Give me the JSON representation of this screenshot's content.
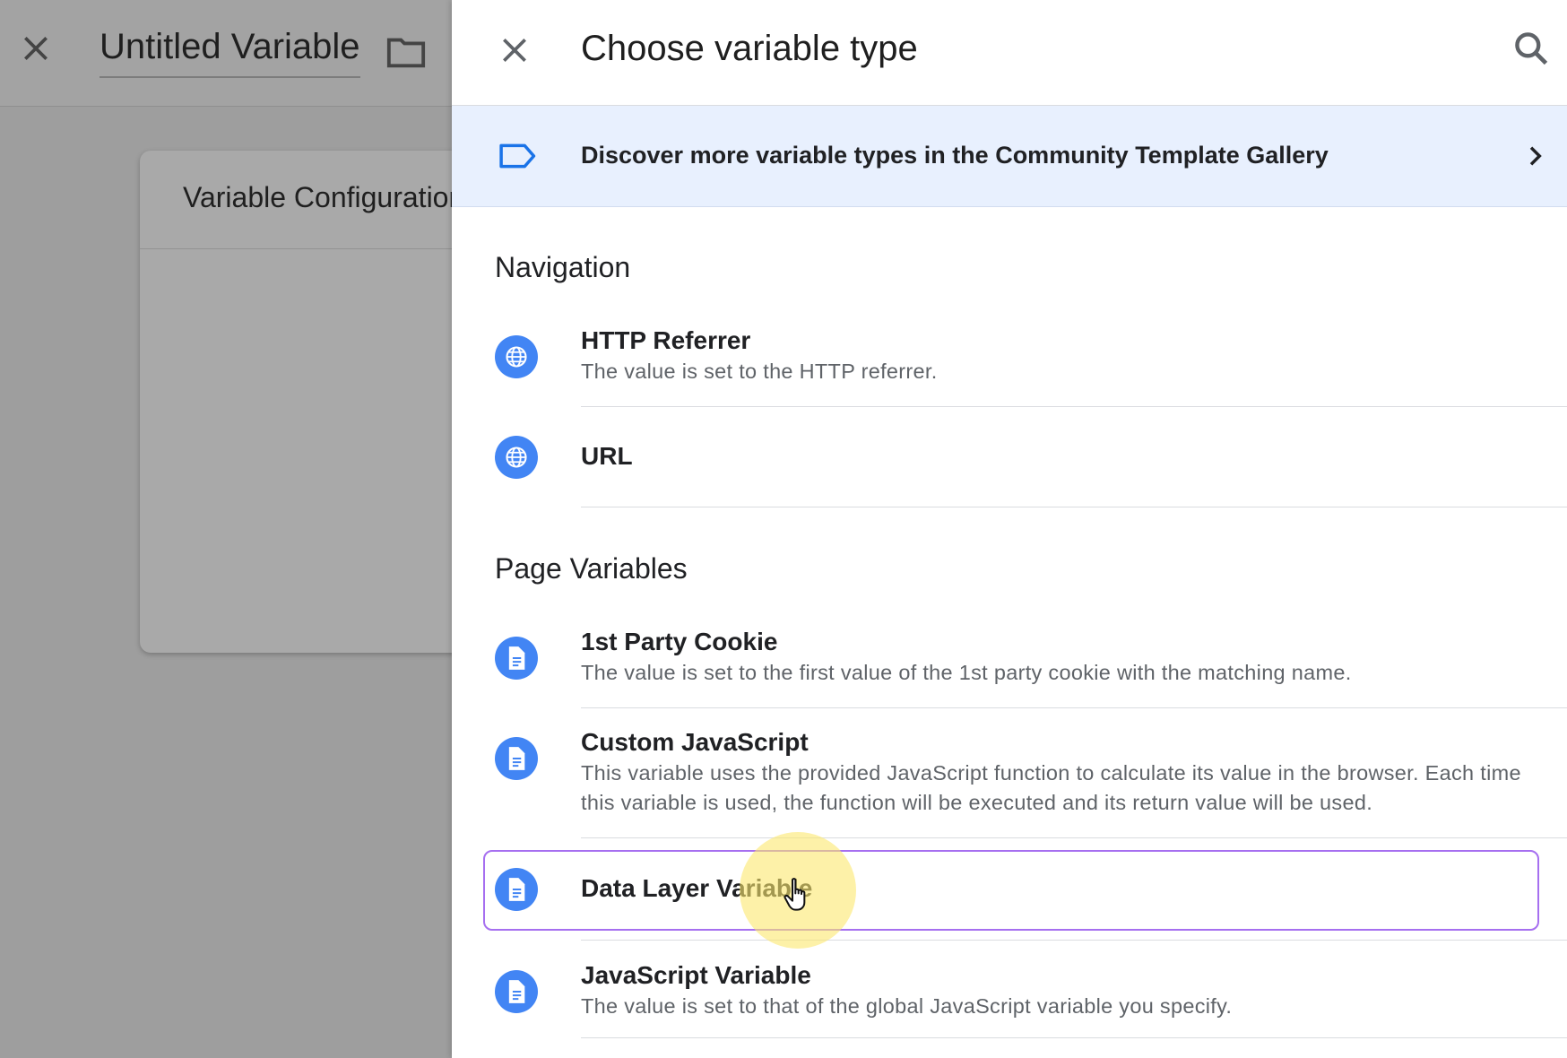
{
  "editor": {
    "title": "Untitled Variable",
    "card_title": "Variable Configuration"
  },
  "panel": {
    "title": "Choose variable type",
    "banner": "Discover more variable types in the Community Template Gallery",
    "sections": [
      {
        "title": "Navigation",
        "items": [
          {
            "name": "HTTP Referrer",
            "desc": "The value is set to the HTTP referrer.",
            "icon": "globe-icon"
          },
          {
            "name": "URL",
            "desc": "",
            "icon": "globe-icon"
          }
        ]
      },
      {
        "title": "Page Variables",
        "items": [
          {
            "name": "1st Party Cookie",
            "desc": "The value is set to the first value of the 1st party cookie with the matching name.",
            "icon": "document-icon"
          },
          {
            "name": "Custom JavaScript",
            "desc": "This variable uses the provided JavaScript function to calculate its value in the browser. Each time this variable is used, the function will be executed and its return value will be used.",
            "icon": "document-icon"
          },
          {
            "name": "Data Layer Variable",
            "desc": "",
            "icon": "document-icon",
            "selected": true
          },
          {
            "name": "JavaScript Variable",
            "desc": "The value is set to that of the global JavaScript variable you specify.",
            "icon": "document-icon"
          }
        ]
      }
    ]
  },
  "colors": {
    "accent": "#4285f4",
    "banner_bg": "#e8f0fe",
    "selection": "#a66ff0",
    "overlay": "#9e9e9e"
  }
}
